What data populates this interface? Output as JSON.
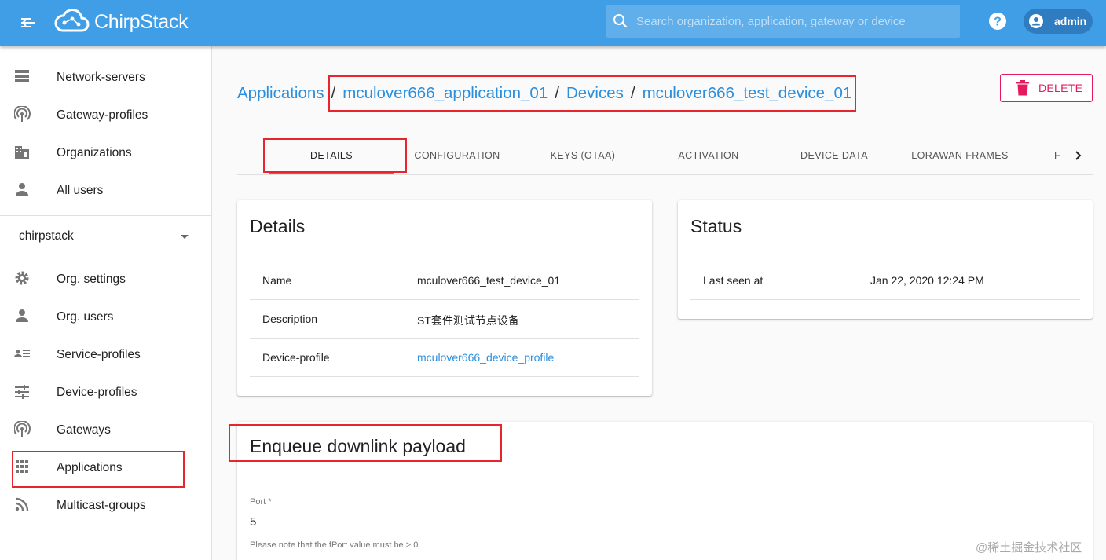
{
  "appbar": {
    "logo_text": "ChirpStack",
    "search_placeholder": "Search organization, application, gateway or device",
    "user_name": "admin"
  },
  "sidebar": {
    "global_items": [
      {
        "label": "Network-servers",
        "icon": "server-icon"
      },
      {
        "label": "Gateway-profiles",
        "icon": "broadcast-icon"
      },
      {
        "label": "Organizations",
        "icon": "building-icon"
      },
      {
        "label": "All users",
        "icon": "person-icon"
      }
    ],
    "org_select_value": "chirpstack",
    "org_items": [
      {
        "label": "Org. settings",
        "icon": "gear-icon"
      },
      {
        "label": "Org. users",
        "icon": "person-icon"
      },
      {
        "label": "Service-profiles",
        "icon": "list-person-icon"
      },
      {
        "label": "Device-profiles",
        "icon": "tune-icon"
      },
      {
        "label": "Gateways",
        "icon": "broadcast-icon"
      },
      {
        "label": "Applications",
        "icon": "apps-icon"
      },
      {
        "label": "Multicast-groups",
        "icon": "rss-icon"
      }
    ]
  },
  "breadcrumb": {
    "items": [
      "Applications",
      "mculover666_application_01",
      "Devices",
      "mculover666_test_device_01"
    ],
    "separator": "/"
  },
  "delete_label": "DELETE",
  "tabs": [
    "DETAILS",
    "CONFIGURATION",
    "KEYS (OTAA)",
    "ACTIVATION",
    "DEVICE DATA",
    "LORAWAN FRAMES",
    "F"
  ],
  "active_tab": "DETAILS",
  "details_card": {
    "title": "Details",
    "rows": [
      {
        "key": "Name",
        "value": "mculover666_test_device_01"
      },
      {
        "key": "Description",
        "value": "ST套件测试节点设备"
      },
      {
        "key": "Device-profile",
        "value": "mculover666_device_profile"
      }
    ]
  },
  "status_card": {
    "title": "Status",
    "rows": [
      {
        "key": "Last seen at",
        "value": "Jan 22, 2020 12:24 PM"
      }
    ]
  },
  "downlink_card": {
    "title": "Enqueue downlink payload",
    "port_label": "Port *",
    "port_value": "5",
    "port_help": "Please note that the fPort value must be > 0."
  },
  "watermark": "@稀土掘金技术社区",
  "colors": {
    "appbar": "#3f9ee6",
    "link": "#2b8fde",
    "delete": "#e31b5c",
    "highlight_box": "#e8252c"
  }
}
